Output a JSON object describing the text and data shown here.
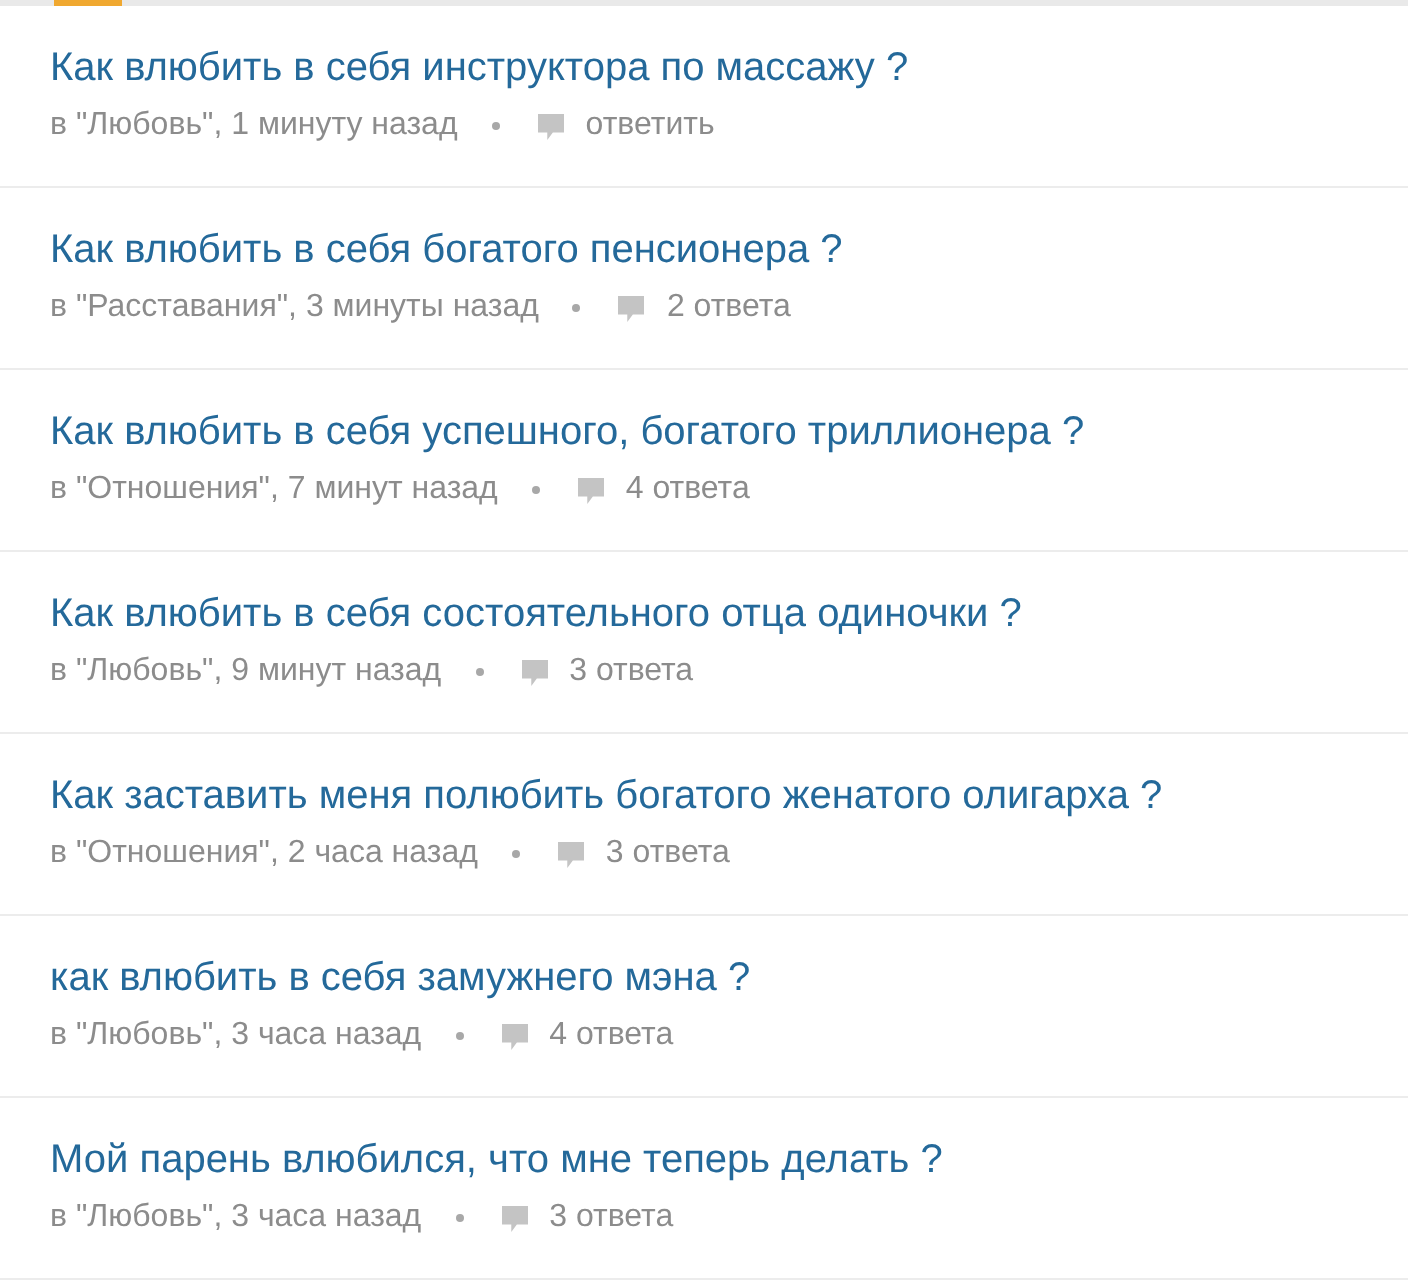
{
  "questions": [
    {
      "title": "Как влюбить в себя инструктора по массажу ?",
      "meta": "в \"Любовь\", 1 минуту назад",
      "answers": "ответить"
    },
    {
      "title": "Как влюбить в себя богатого пенсионера ?",
      "meta": "в \"Расставания\", 3 минуты назад",
      "answers": "2 ответа"
    },
    {
      "title": "Как влюбить в себя успешного, богатого триллионера ?",
      "meta": "в \"Отношения\", 7 минут назад",
      "answers": "4 ответа"
    },
    {
      "title": "Как влюбить в себя состоятельного отца одиночки ?",
      "meta": "в \"Любовь\", 9 минут назад",
      "answers": "3 ответа"
    },
    {
      "title": "Как заставить меня полюбить богатого женатого олигарха ?",
      "meta": "в \"Отношения\", 2 часа назад",
      "answers": "3 ответа"
    },
    {
      "title": "как влюбить в себя замужнего мэна ?",
      "meta": "в \"Любовь\", 3 часа назад",
      "answers": "4 ответа"
    },
    {
      "title": "Мой парень влюбился, что мне теперь делать ?",
      "meta": "в \"Любовь\", 3 часа назад",
      "answers": "3 ответа"
    }
  ]
}
